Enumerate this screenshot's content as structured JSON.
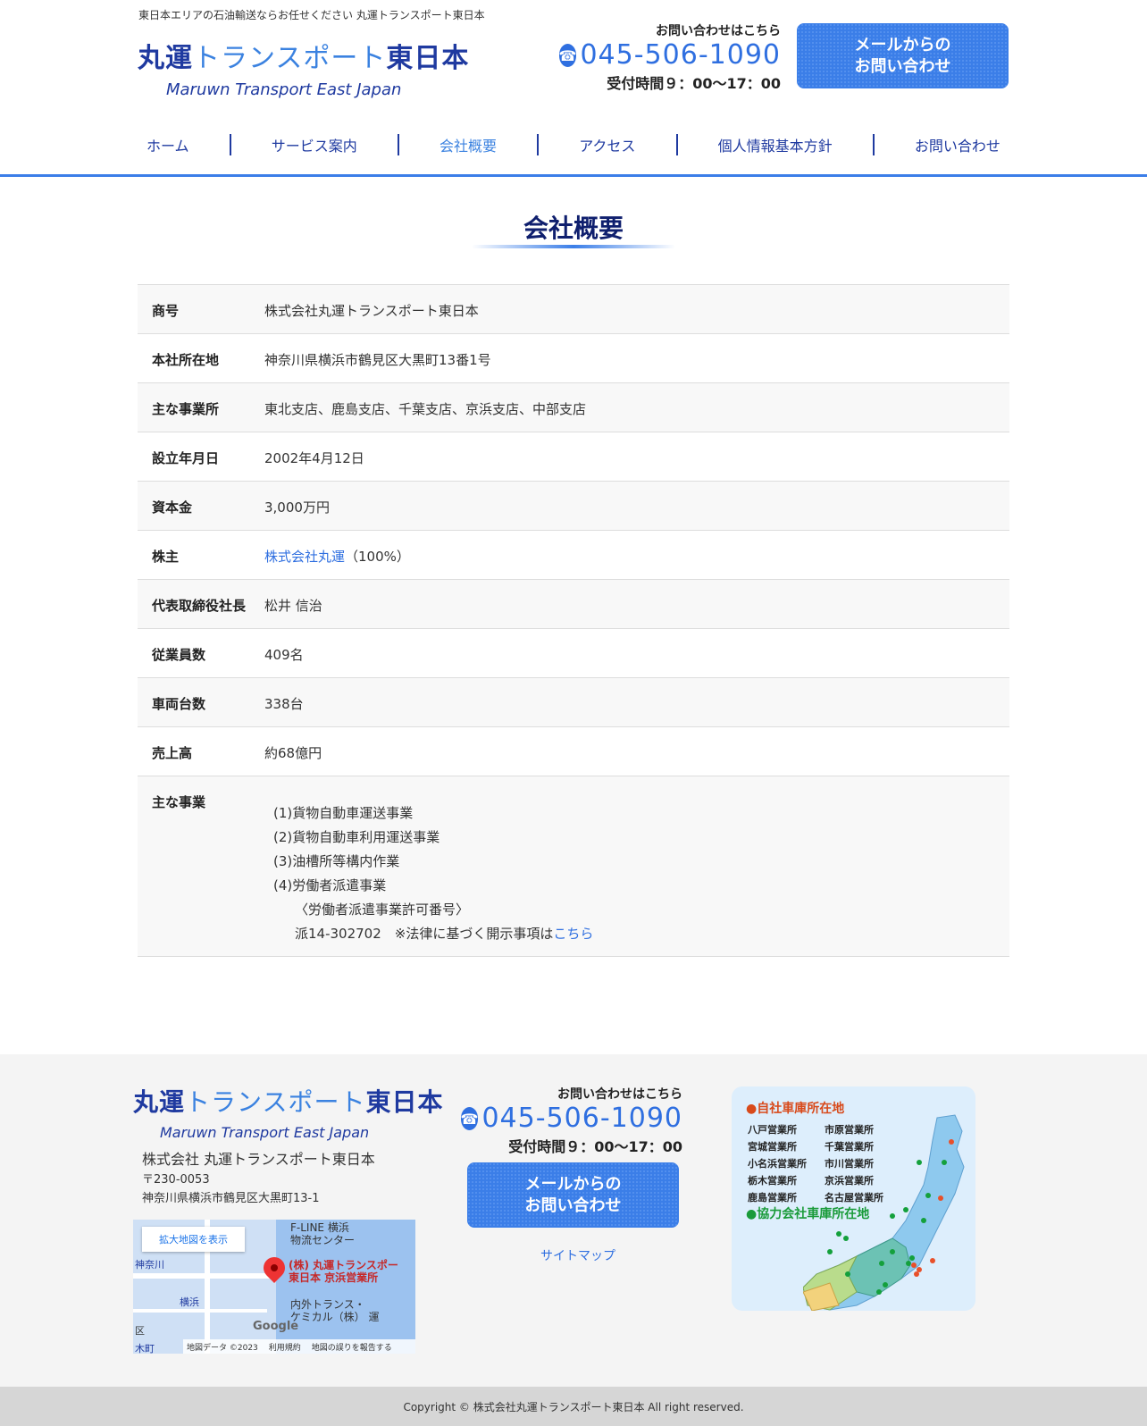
{
  "header": {
    "tagline": "東日本エリアの石油輸送ならお任せください 丸運トランスポート東日本",
    "logo_jp_1": "丸運",
    "logo_jp_2": "トランスポート",
    "logo_jp_3": "東日本",
    "logo_en": "Maruwn Transport East Japan",
    "tel_label": "お問い合わせはこちら",
    "tel_number": "045-506-1090",
    "tel_hours": "受付時間９：00～17：00",
    "mail_btn_line1": "メールからの",
    "mail_btn_line2": "お問い合わせ"
  },
  "nav": {
    "items": [
      {
        "label": "ホーム"
      },
      {
        "label": "サービス案内"
      },
      {
        "label": "会社概要"
      },
      {
        "label": "アクセス"
      },
      {
        "label": "個人情報基本方針"
      },
      {
        "label": "お問い合わせ"
      }
    ]
  },
  "page": {
    "title": "会社概要"
  },
  "table": {
    "rows": [
      {
        "label": "商号",
        "value": "株式会社丸運トランスポート東日本"
      },
      {
        "label": "本社所在地",
        "value": "神奈川県横浜市鶴見区大黒町13番1号"
      },
      {
        "label": "主な事業所",
        "value": "東北支店、鹿島支店、千葉支店、京浜支店、中部支店"
      },
      {
        "label": "設立年月日",
        "value": "2002年4月12日"
      },
      {
        "label": "資本金",
        "value": "3,000万円"
      },
      {
        "label": "株主",
        "link": "株式会社丸運",
        "value": "（100%）"
      },
      {
        "label": "代表取締役社長",
        "value": "松井 信治"
      },
      {
        "label": "従業員数",
        "value": "409名"
      },
      {
        "label": "車両台数",
        "value": "338台"
      },
      {
        "label": "売上高",
        "value": "約68億円"
      },
      {
        "label": "主な事業"
      }
    ],
    "business": {
      "items": [
        "(1)貨物自動車運送事業",
        "(2)貨物自動車利用運送事業",
        "(3)油槽所等構内作業",
        "(4)労働者派遣事業"
      ],
      "permit_label": "〈労働者派遣事業許可番号〉",
      "permit_text": "派14-302702　※法律に基づく開示事項は",
      "permit_link": "こちら"
    }
  },
  "footer": {
    "company": "株式会社 丸運トランスポート東日本",
    "zip": "〒230-0053",
    "address": "神奈川県横浜市鶴見区大黒町13-1",
    "map": {
      "enlarge": "拡大地図を表示",
      "pin_label_1": "(株) 丸運トランスポー",
      "pin_label_2": "東日本 京浜営業所",
      "poi_1a": "F-LINE 横浜",
      "poi_1b": "物流センター",
      "poi_2a": "内外トランス・",
      "poi_2b": "ケミカル（株） 運",
      "place_1": "神奈川",
      "place_2": "横浜",
      "place_3": "区",
      "place_4": "木町",
      "google": "Google",
      "bar_1": "地図データ ©2023",
      "bar_2": "利用規約",
      "bar_3": "地図の誤りを報告する"
    },
    "tel_label": "お問い合わせはこちら",
    "tel_number": "045-506-1090",
    "tel_hours": "受付時間９：00～17：00",
    "mail_btn_line1": "メールからの",
    "mail_btn_line2": "お問い合わせ",
    "sitemap": "サイトマップ",
    "garage": {
      "title": "●自社車庫所在地",
      "offices": [
        "八戸営業所",
        "市原営業所",
        "宮城営業所",
        "千葉営業所",
        "小名浜営業所",
        "市川営業所",
        "栃木営業所",
        "京浜営業所",
        "鹿島営業所",
        "名古屋営業所"
      ],
      "title2": "●協力会社車庫所在地"
    },
    "copyright": "Copyright © 株式会社丸運トランスポート東日本 All right reserved."
  },
  "colors": {
    "brand_dark": "#1f3aa0",
    "brand_accent": "#3b7ee8",
    "title_navy": "#0f1f6e"
  }
}
